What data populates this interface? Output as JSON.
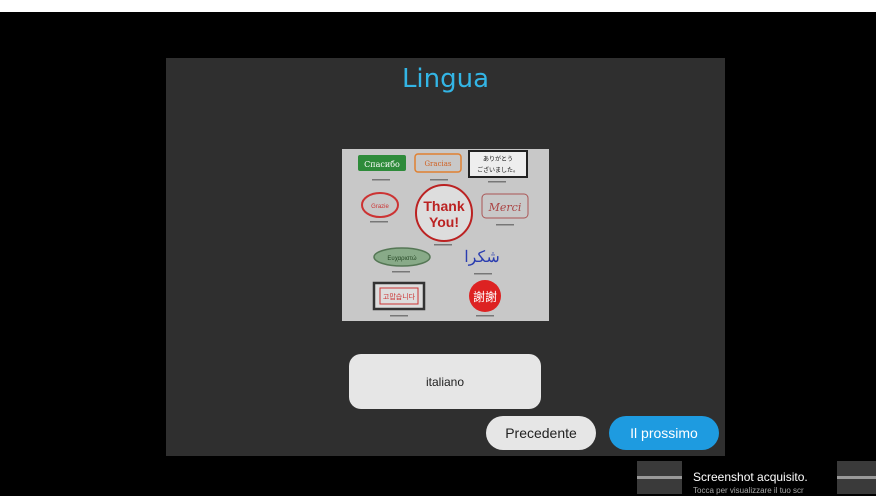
{
  "dialog": {
    "title": "Lingua",
    "selected_language": "italiano",
    "buttons": {
      "previous": "Precedente",
      "next": "Il prossimo"
    },
    "image": {
      "stamps": [
        "Спасибо",
        "Gracias",
        "ありがとう ございました。",
        "Grazie",
        "Thank You!",
        "Merci",
        "Ευχαριστώ",
        "شكرا",
        "고맙습니다",
        "謝謝"
      ]
    }
  },
  "notification": {
    "title": "Screenshot acquisito.",
    "subtitle": "Tocca per visualizzare il tuo scr"
  },
  "colors": {
    "accent": "#33b5e5",
    "button_primary": "#1e9be0",
    "dialog_bg": "#2f2f2f"
  }
}
